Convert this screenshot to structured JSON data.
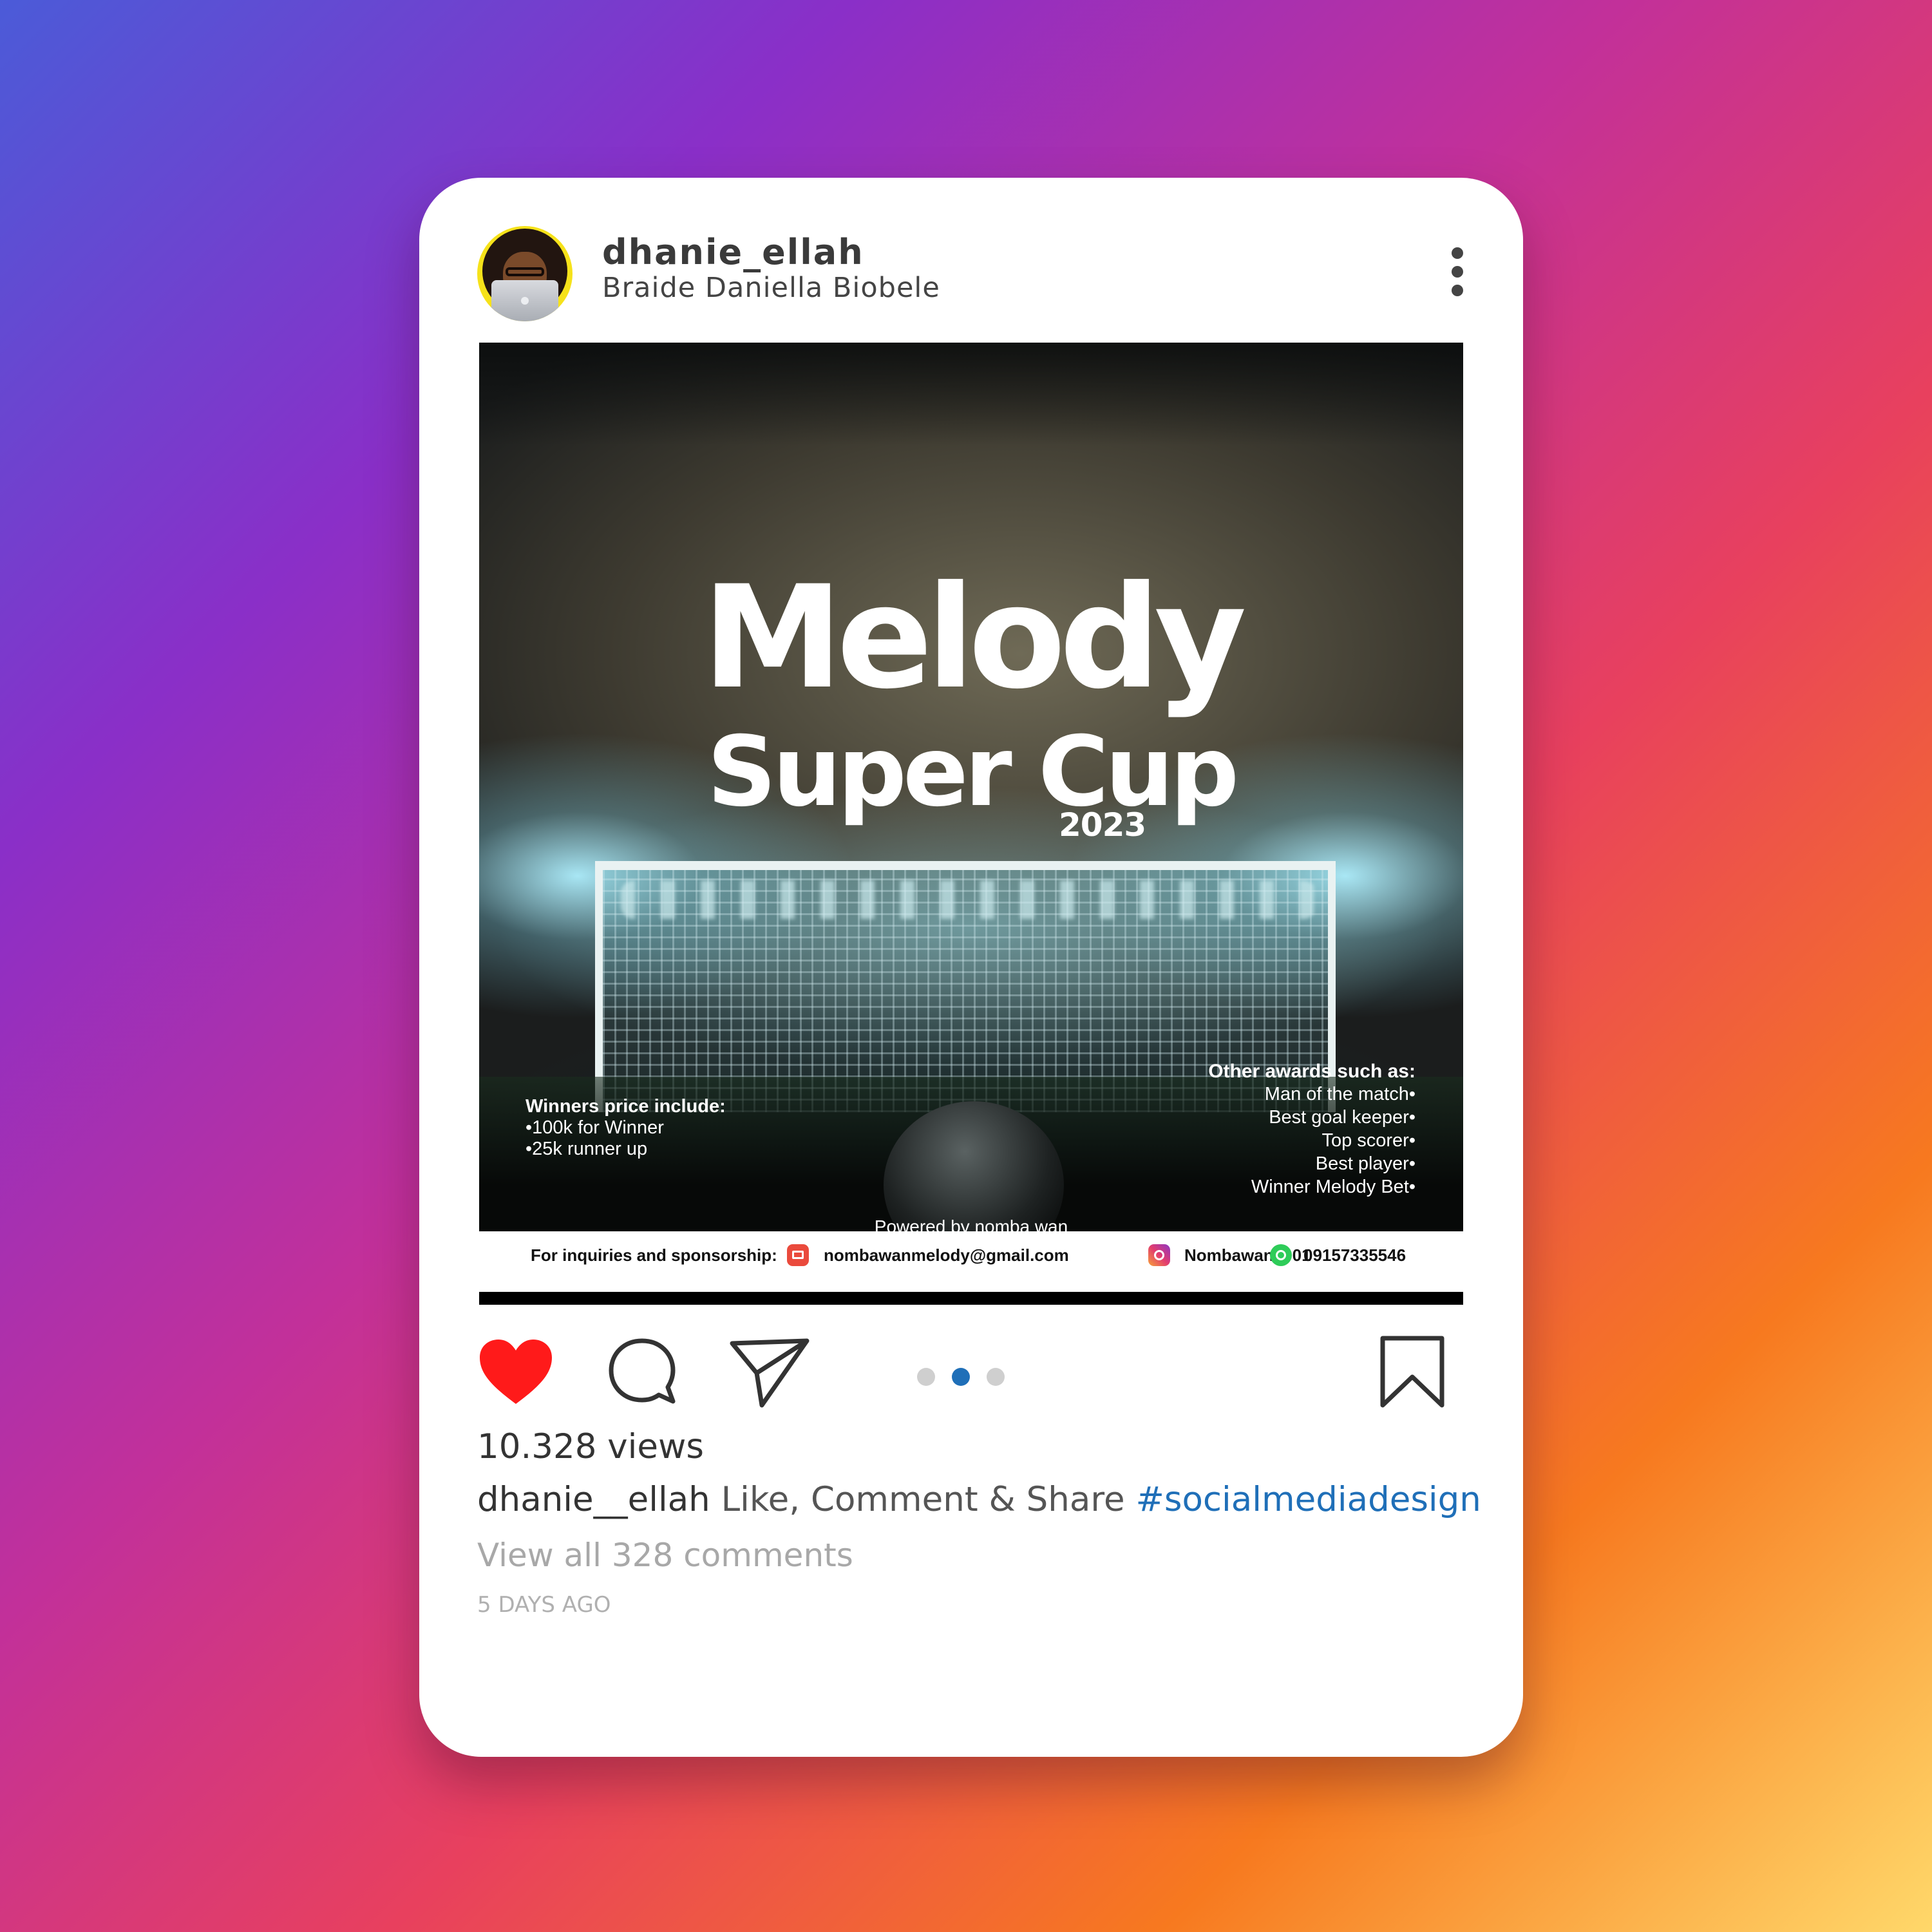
{
  "post": {
    "username": "dhanie_ellah",
    "full_name": "Braide Daniella Biobele",
    "more_icon": "vertical-ellipsis-icon"
  },
  "flyer": {
    "title_line1": "Melody",
    "title_line2": "Super  Cup",
    "year": "2023",
    "prize_heading": "Winners price include:",
    "prize_lines": [
      "•100k  for Winner",
      "•25k runner up"
    ],
    "awards_heading": "Other awards such as:",
    "awards_lines": [
      "Man of the match•",
      "Best goal keeper•",
      "Top scorer•",
      "Best player•",
      "Winner Melody Bet•"
    ],
    "powered_by": "Powered by nomba wan",
    "contact_label": "For inquiries and sponsorship:",
    "email": "nombawanmelody@gmail.com",
    "instagram": "Nombawan_001",
    "phone": "09157335546"
  },
  "actions": {
    "like_icon": "heart-icon",
    "comment_icon": "comment-icon",
    "share_icon": "send-icon",
    "save_icon": "bookmark-icon",
    "like_color": "#ff1a1a"
  },
  "carousel": {
    "total": 3,
    "active_index": 1,
    "active_color": "#1f6fb8"
  },
  "stats": {
    "views": "10.328 views"
  },
  "caption": {
    "user": "dhanie__ellah",
    "text": " Like, Comment & Share ",
    "hashtag": "#socialmediadesign"
  },
  "comments_link": "View all 328 comments",
  "timestamp": "5 DAYS AGO"
}
